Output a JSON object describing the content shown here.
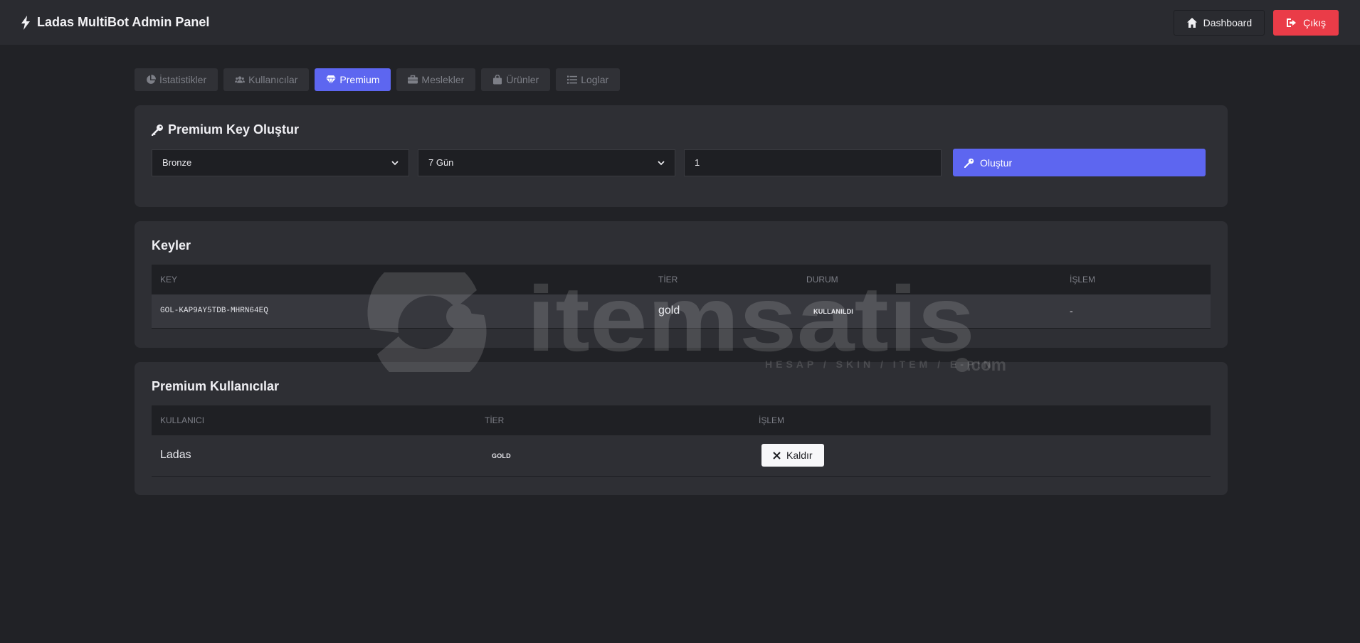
{
  "app": {
    "title": "Ladas MultiBot Admin Panel",
    "dashboard_label": "Dashboard",
    "logout_label": "Çıkış"
  },
  "tabs": [
    {
      "label": "İstatistikler",
      "icon": "chart-pie-icon",
      "active": false
    },
    {
      "label": "Kullanıcılar",
      "icon": "users-icon",
      "active": false
    },
    {
      "label": "Premium",
      "icon": "gem-icon",
      "active": true
    },
    {
      "label": "Meslekler",
      "icon": "briefcase-icon",
      "active": false
    },
    {
      "label": "Ürünler",
      "icon": "bag-icon",
      "active": false
    },
    {
      "label": "Loglar",
      "icon": "list-icon",
      "active": false
    }
  ],
  "create_key": {
    "title": "Premium Key Oluştur",
    "tier_select": "Bronze",
    "duration_select": "7 Gün",
    "quantity": "1",
    "button_label": "Oluştur"
  },
  "keys": {
    "title": "Keyler",
    "columns": [
      "KEY",
      "TİER",
      "DURUM",
      "İŞLEM"
    ],
    "rows": [
      {
        "key": "GOL-KAP9AY5TDB-MHRN64EQ",
        "tier": "gold",
        "status": "KULLANILDI",
        "action": "-"
      }
    ]
  },
  "premium_users": {
    "title": "Premium Kullanıcılar",
    "columns": [
      "KULLANICI",
      "TİER",
      "İŞLEM"
    ],
    "rows": [
      {
        "user": "Ladas",
        "tier": "GOLD",
        "action_label": "Kaldır"
      }
    ]
  },
  "watermark": {
    "brand": "itemsatis",
    "tagline": "HESAP / SKIN / ITEM / E-PIN",
    "suffix": ".com"
  },
  "colors": {
    "accent": "#5d66f0",
    "danger": "#ea3c48",
    "background": "#212226",
    "card": "#2e2f34"
  }
}
